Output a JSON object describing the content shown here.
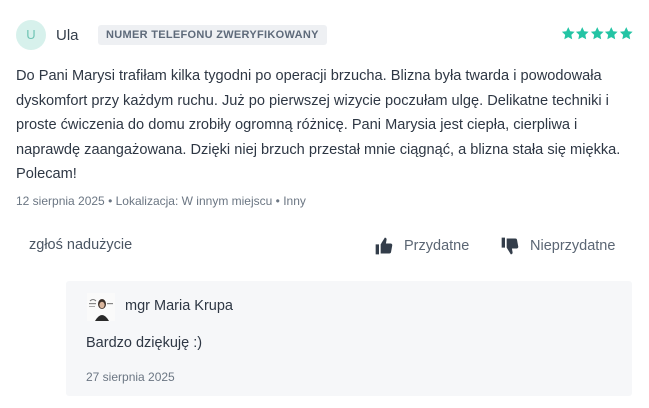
{
  "review": {
    "avatar_initial": "U",
    "author": "Ula",
    "badge": "NUMER TELEFONU ZWERYFIKOWANY",
    "rating": 5,
    "rating_max": 5,
    "star_color": "#23c4a4",
    "text": "Do Pani Marysi trafiłam kilka tygodni po operacji brzucha. Blizna była twarda i powodowała dyskomfort przy każdym ruchu. Już po pierwszej wizycie poczułam ulgę. Delikatne techniki i proste ćwiczenia do domu zrobiły ogromną różnicę. Pani Marysia jest ciepła, cierpliwa i naprawdę zaangażowana. Dzięki niej brzuch przestał mnie ciągnąć, a blizna stała się miękka. Polecam!",
    "meta": "12 sierpnia 2025 • Lokalizacja: W innym miejscu • Inny"
  },
  "actions": {
    "report_label": "zgłoś nadużycie",
    "helpful_label": "Przydatne",
    "unhelpful_label": "Nieprzydatne"
  },
  "reply": {
    "doctor_photo_icon": "doctor-photo",
    "doctor_name": "mgr Maria Krupa",
    "text": "Bardzo dziękuję :)",
    "date": "27 sierpnia 2025"
  }
}
